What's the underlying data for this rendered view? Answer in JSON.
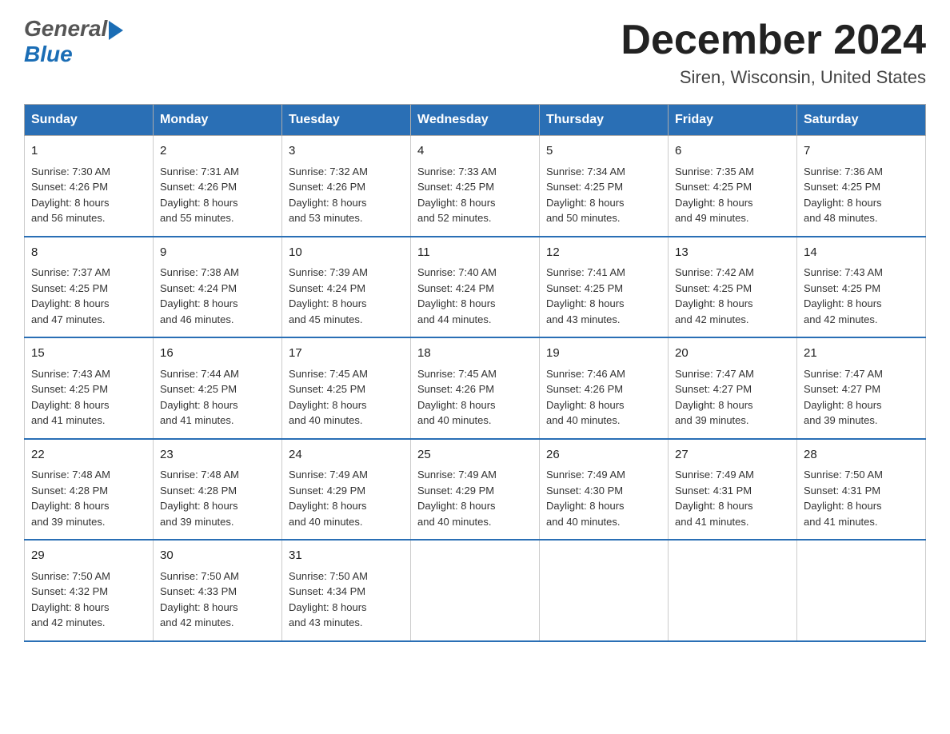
{
  "header": {
    "logo_general": "General",
    "logo_blue": "Blue",
    "main_title": "December 2024",
    "subtitle": "Siren, Wisconsin, United States"
  },
  "calendar": {
    "days_of_week": [
      "Sunday",
      "Monday",
      "Tuesday",
      "Wednesday",
      "Thursday",
      "Friday",
      "Saturday"
    ],
    "weeks": [
      [
        {
          "date": "1",
          "sunrise": "7:30 AM",
          "sunset": "4:26 PM",
          "daylight": "8 hours and 56 minutes."
        },
        {
          "date": "2",
          "sunrise": "7:31 AM",
          "sunset": "4:26 PM",
          "daylight": "8 hours and 55 minutes."
        },
        {
          "date": "3",
          "sunrise": "7:32 AM",
          "sunset": "4:26 PM",
          "daylight": "8 hours and 53 minutes."
        },
        {
          "date": "4",
          "sunrise": "7:33 AM",
          "sunset": "4:25 PM",
          "daylight": "8 hours and 52 minutes."
        },
        {
          "date": "5",
          "sunrise": "7:34 AM",
          "sunset": "4:25 PM",
          "daylight": "8 hours and 50 minutes."
        },
        {
          "date": "6",
          "sunrise": "7:35 AM",
          "sunset": "4:25 PM",
          "daylight": "8 hours and 49 minutes."
        },
        {
          "date": "7",
          "sunrise": "7:36 AM",
          "sunset": "4:25 PM",
          "daylight": "8 hours and 48 minutes."
        }
      ],
      [
        {
          "date": "8",
          "sunrise": "7:37 AM",
          "sunset": "4:25 PM",
          "daylight": "8 hours and 47 minutes."
        },
        {
          "date": "9",
          "sunrise": "7:38 AM",
          "sunset": "4:24 PM",
          "daylight": "8 hours and 46 minutes."
        },
        {
          "date": "10",
          "sunrise": "7:39 AM",
          "sunset": "4:24 PM",
          "daylight": "8 hours and 45 minutes."
        },
        {
          "date": "11",
          "sunrise": "7:40 AM",
          "sunset": "4:24 PM",
          "daylight": "8 hours and 44 minutes."
        },
        {
          "date": "12",
          "sunrise": "7:41 AM",
          "sunset": "4:25 PM",
          "daylight": "8 hours and 43 minutes."
        },
        {
          "date": "13",
          "sunrise": "7:42 AM",
          "sunset": "4:25 PM",
          "daylight": "8 hours and 42 minutes."
        },
        {
          "date": "14",
          "sunrise": "7:43 AM",
          "sunset": "4:25 PM",
          "daylight": "8 hours and 42 minutes."
        }
      ],
      [
        {
          "date": "15",
          "sunrise": "7:43 AM",
          "sunset": "4:25 PM",
          "daylight": "8 hours and 41 minutes."
        },
        {
          "date": "16",
          "sunrise": "7:44 AM",
          "sunset": "4:25 PM",
          "daylight": "8 hours and 41 minutes."
        },
        {
          "date": "17",
          "sunrise": "7:45 AM",
          "sunset": "4:25 PM",
          "daylight": "8 hours and 40 minutes."
        },
        {
          "date": "18",
          "sunrise": "7:45 AM",
          "sunset": "4:26 PM",
          "daylight": "8 hours and 40 minutes."
        },
        {
          "date": "19",
          "sunrise": "7:46 AM",
          "sunset": "4:26 PM",
          "daylight": "8 hours and 40 minutes."
        },
        {
          "date": "20",
          "sunrise": "7:47 AM",
          "sunset": "4:27 PM",
          "daylight": "8 hours and 39 minutes."
        },
        {
          "date": "21",
          "sunrise": "7:47 AM",
          "sunset": "4:27 PM",
          "daylight": "8 hours and 39 minutes."
        }
      ],
      [
        {
          "date": "22",
          "sunrise": "7:48 AM",
          "sunset": "4:28 PM",
          "daylight": "8 hours and 39 minutes."
        },
        {
          "date": "23",
          "sunrise": "7:48 AM",
          "sunset": "4:28 PM",
          "daylight": "8 hours and 39 minutes."
        },
        {
          "date": "24",
          "sunrise": "7:49 AM",
          "sunset": "4:29 PM",
          "daylight": "8 hours and 40 minutes."
        },
        {
          "date": "25",
          "sunrise": "7:49 AM",
          "sunset": "4:29 PM",
          "daylight": "8 hours and 40 minutes."
        },
        {
          "date": "26",
          "sunrise": "7:49 AM",
          "sunset": "4:30 PM",
          "daylight": "8 hours and 40 minutes."
        },
        {
          "date": "27",
          "sunrise": "7:49 AM",
          "sunset": "4:31 PM",
          "daylight": "8 hours and 41 minutes."
        },
        {
          "date": "28",
          "sunrise": "7:50 AM",
          "sunset": "4:31 PM",
          "daylight": "8 hours and 41 minutes."
        }
      ],
      [
        {
          "date": "29",
          "sunrise": "7:50 AM",
          "sunset": "4:32 PM",
          "daylight": "8 hours and 42 minutes."
        },
        {
          "date": "30",
          "sunrise": "7:50 AM",
          "sunset": "4:33 PM",
          "daylight": "8 hours and 42 minutes."
        },
        {
          "date": "31",
          "sunrise": "7:50 AM",
          "sunset": "4:34 PM",
          "daylight": "8 hours and 43 minutes."
        },
        null,
        null,
        null,
        null
      ]
    ],
    "labels": {
      "sunrise": "Sunrise:",
      "sunset": "Sunset:",
      "daylight": "Daylight:"
    }
  }
}
